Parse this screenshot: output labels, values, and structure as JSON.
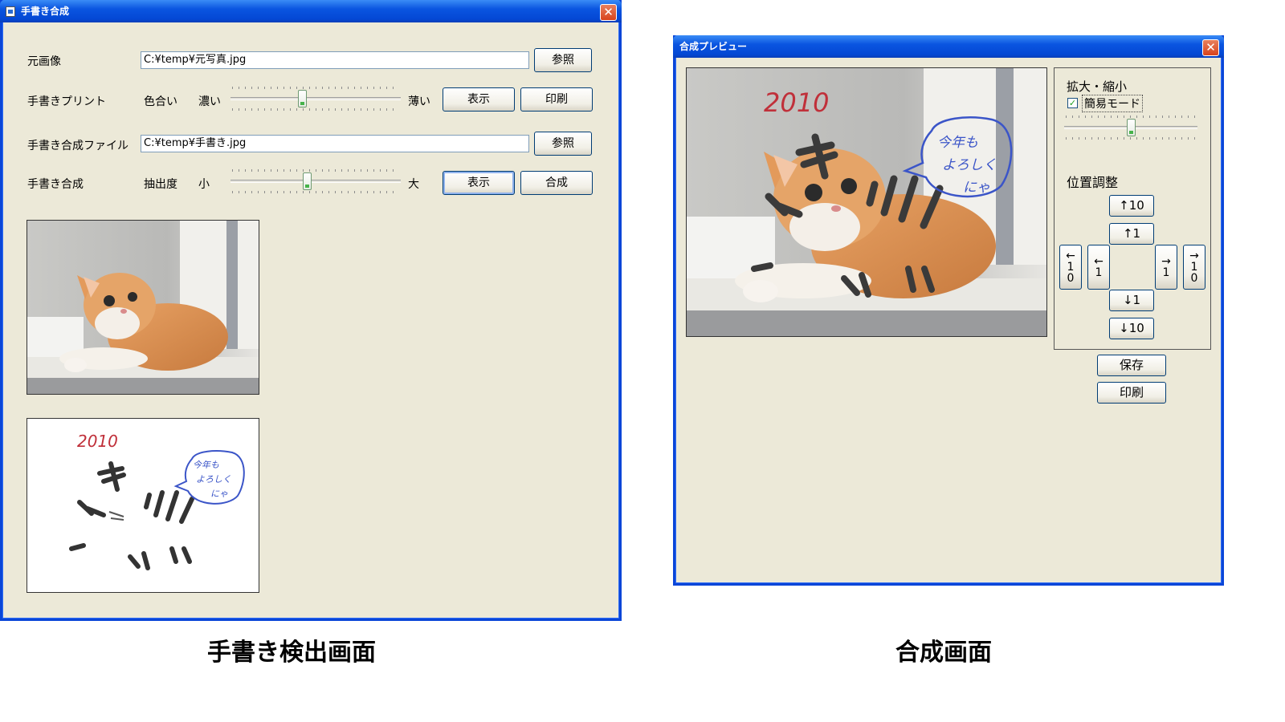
{
  "left_window": {
    "title": "手書き合成",
    "close_glyph": "✕",
    "rows": {
      "source_label": "元画像",
      "source_path": "C:¥temp¥元写真.jpg",
      "source_browse": "参照",
      "print_label": "手書きプリント",
      "print_color_label": "色合い",
      "print_dark_label": "濃い",
      "print_light_label": "薄い",
      "print_show": "表示",
      "print_print": "印刷",
      "file_label": "手書き合成ファイル",
      "file_path": "C:¥temp¥手書き.jpg",
      "file_browse": "参照",
      "compose_label": "手書き合成",
      "extract_label": "抽出度",
      "extract_small": "小",
      "extract_large": "大",
      "compose_show": "表示",
      "compose_go": "合成"
    },
    "color_slider_value": 0.42,
    "extract_slider_value": 0.45,
    "handwriting": {
      "year": "2010",
      "bubble_line1": "今年も",
      "bubble_line2": "よろしく",
      "bubble_line3": "にゃ"
    }
  },
  "right_window": {
    "title": "合成プレビュー",
    "close_glyph": "✕",
    "zoom_label": "拡大・縮小",
    "simple_mode_label": "簡易モード",
    "simple_mode_checked": true,
    "check_glyph": "✓",
    "zoom_slider_value": 0.5,
    "position_label": "位置調整",
    "up10": "↑10",
    "up1": "↑1",
    "down1": "↓1",
    "down10": "↓10",
    "left10": [
      "←",
      "1",
      "0"
    ],
    "left1": [
      "←",
      "1"
    ],
    "right1": [
      "→",
      "1"
    ],
    "right10": [
      "→",
      "1",
      "0"
    ],
    "save": "保存",
    "print": "印刷",
    "handwriting": {
      "year": "2010",
      "bubble_line1": "今年も",
      "bubble_line2": "よろしく",
      "bubble_line3": "にゃ"
    }
  },
  "captions": {
    "left": "手書き検出画面",
    "right": "合成画面"
  },
  "colors": {
    "window_bg": "#ece9d8",
    "title_blue": "#0a55e0",
    "ink_red": "#c0303a",
    "ink_blue": "#3b55c8",
    "ink_dark": "#3a3a3a"
  }
}
